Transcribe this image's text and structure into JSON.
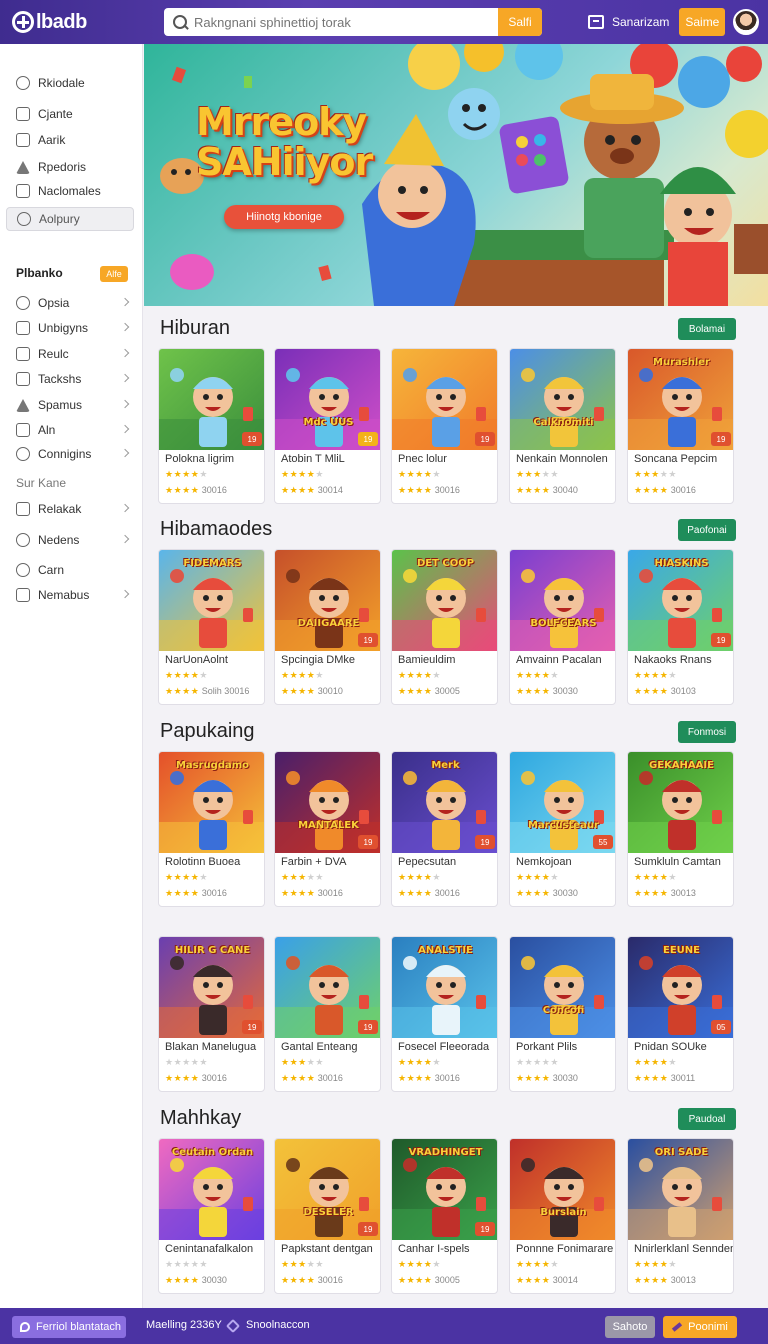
{
  "header": {
    "logo": "lbadb",
    "search_placeholder": "Rakngnani sphinettioj torak",
    "search_button": "Salfi",
    "user_name": "Sanarizam",
    "action_button": "Saime"
  },
  "sidebar": {
    "items": [
      {
        "label": "Rkiodale"
      },
      {
        "label": "Cjante"
      },
      {
        "label": "Aarik"
      },
      {
        "label": "Rpedoris"
      },
      {
        "label": "Naclomales"
      },
      {
        "label": "Aolpury"
      }
    ],
    "heading": "Plbanko",
    "heading_badge": "Alfe",
    "group_items": [
      {
        "label": "Opsia"
      },
      {
        "label": "Unbigyns"
      },
      {
        "label": "Reulc"
      },
      {
        "label": "Tackshs"
      },
      {
        "label": "Spamus"
      },
      {
        "label": "Aln"
      },
      {
        "label": "Connigins"
      }
    ],
    "sub_heading": "Sur Kane",
    "more_items": [
      {
        "label": "Relakak"
      },
      {
        "label": "Nedens"
      },
      {
        "label": "Carn"
      },
      {
        "label": "Nemabus"
      }
    ]
  },
  "hero": {
    "title_line1": "Mrreoky",
    "title_line2": "SAHiiyor",
    "button": "Hiinotg kbonige"
  },
  "sections": [
    {
      "title": "Hiburan",
      "button": "Bolamai",
      "cards": [
        {
          "title": "Polokna ligrim",
          "badge": "19",
          "stars": 4,
          "meta": "30016"
        },
        {
          "title": "Atobin T MliL",
          "badge": "19",
          "stars": 4,
          "meta": "30014",
          "art_text": "Mdc UUS"
        },
        {
          "title": "Pnec lolur",
          "badge": "19",
          "stars": 4,
          "meta": "30016"
        },
        {
          "title": "Nenkain Monnolen",
          "badge": "",
          "stars": 3,
          "meta": "30040",
          "art_text": "Calknomiti"
        },
        {
          "title": "Soncana Pepcim",
          "badge": "19",
          "stars": 3,
          "meta": "30016",
          "art_text": "Murashler"
        }
      ]
    },
    {
      "title": "Hibamaodes",
      "button": "Paofonai",
      "cards": [
        {
          "title": "NarUonAolnt",
          "badge": "",
          "stars": 4,
          "meta": "Solih 30016",
          "art_text": "FIDEMARS"
        },
        {
          "title": "Spcingia DMke",
          "badge": "19",
          "stars": 4,
          "meta": "30010",
          "art_text": "DAIIGAARE"
        },
        {
          "title": "Bamieuldim",
          "badge": "",
          "stars": 4,
          "meta": "30005",
          "art_text": "DET COOP"
        },
        {
          "title": "Amvainn Pacalan",
          "badge": "",
          "stars": 4,
          "meta": "30030",
          "art_text": "BOLFCEARS"
        },
        {
          "title": "Nakaoks Rnans",
          "badge": "19",
          "stars": 4,
          "meta": "30103",
          "art_text": "HIASKINS"
        }
      ]
    },
    {
      "title": "Papukaing",
      "button": "Fonmosi",
      "cards": [
        {
          "title": "Rolotinn Buoea",
          "badge": "",
          "stars": 4,
          "meta": "30016",
          "art_text": "Masrugdamo"
        },
        {
          "title": "Farbin + DVA",
          "badge": "19",
          "stars": 3,
          "meta": "30016",
          "art_text": "MANTALEK"
        },
        {
          "title": "Pepecsutan",
          "badge": "19",
          "stars": 4,
          "meta": "30016",
          "art_text": "Merk"
        },
        {
          "title": "Nemkojoan",
          "badge": "55",
          "stars": 4,
          "meta": "30030",
          "art_text": "Marcusteaur"
        },
        {
          "title": "Sumkluln Camtan",
          "badge": "",
          "stars": 4,
          "meta": "30013",
          "art_text": "GEKAHAAIE"
        }
      ]
    },
    {
      "title": "",
      "button": "",
      "cards": [
        {
          "title": "Blakan Manelugua",
          "badge": "19",
          "stars": 0,
          "meta": "30016",
          "art_text": "HILIR G CANE"
        },
        {
          "title": "Gantal Enteang",
          "badge": "19",
          "stars": 3,
          "meta": "30016"
        },
        {
          "title": "Fosecel Fleeorada",
          "badge": "",
          "stars": 4,
          "meta": "30016",
          "art_text": "ANALSTIE"
        },
        {
          "title": "Porkant Plils",
          "badge": "",
          "stars": 0,
          "meta": "30030",
          "art_text": "Concofi"
        },
        {
          "title": "Pnidan SOUke",
          "badge": "05",
          "stars": 4,
          "meta": "30011",
          "art_text": "EEUNE"
        }
      ]
    },
    {
      "title": "Mahhkay",
      "button": "Paudoal",
      "cards": [
        {
          "title": "Cenintanafalkalon",
          "badge": "",
          "stars": 0,
          "meta": "30030",
          "art_text": "Ceutain Ordan"
        },
        {
          "title": "Papkstant dentgan",
          "badge": "19",
          "stars": 3,
          "meta": "30016",
          "art_text": "DESELER"
        },
        {
          "title": "Canhar I-spels",
          "badge": "19",
          "stars": 4,
          "meta": "30005",
          "art_text": "VRADHINGET"
        },
        {
          "title": "Ponnne Fonimarare",
          "badge": "",
          "stars": 4,
          "meta": "30014",
          "art_text": "Burslain"
        },
        {
          "title": "Nnirlerklanl Sennden",
          "badge": "",
          "stars": 4,
          "meta": "30013",
          "art_text": "ORI SADE"
        }
      ]
    }
  ],
  "footer": {
    "left_button": "Ferriol blantatach",
    "text1": "Maelling 2336Y",
    "text2": "Snoolnaccon",
    "grey_button": "Sahoto",
    "orange_button": "Poonimi"
  },
  "colors": {
    "header": "#4b33a3",
    "accent": "#f7a726",
    "section_button": "#1f8d5a",
    "badge": "#e0502f"
  }
}
